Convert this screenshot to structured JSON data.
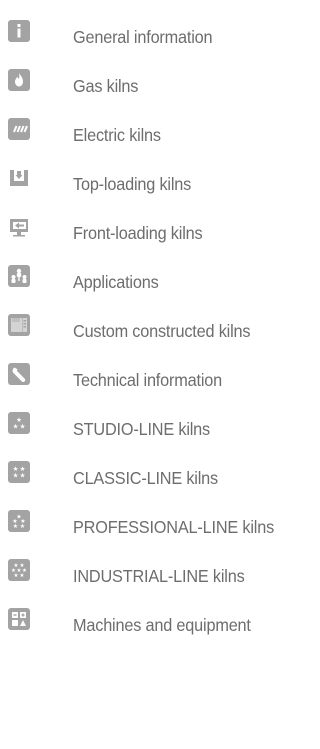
{
  "menu": {
    "items": [
      {
        "label": "General information",
        "icon": "info-icon"
      },
      {
        "label": "Gas kilns",
        "icon": "flame-icon"
      },
      {
        "label": "Electric kilns",
        "icon": "heating-element-icon"
      },
      {
        "label": "Top-loading kilns",
        "icon": "top-loading-icon"
      },
      {
        "label": "Front-loading kilns",
        "icon": "front-loading-icon"
      },
      {
        "label": "Applications",
        "icon": "applications-icon"
      },
      {
        "label": "Custom constructed kilns",
        "icon": "custom-kiln-icon"
      },
      {
        "label": "Technical information",
        "icon": "wrench-icon"
      },
      {
        "label": "STUDIO-LINE kilns",
        "icon": "stars-icon"
      },
      {
        "label": "CLASSIC-LINE kilns",
        "icon": "stars-icon"
      },
      {
        "label": "PROFESSIONAL-LINE kilns",
        "icon": "stars-icon"
      },
      {
        "label": "INDUSTRIAL-LINE kilns",
        "icon": "stars-icon"
      },
      {
        "label": "Machines and equipment",
        "icon": "machines-icon"
      }
    ]
  },
  "colors": {
    "icon_bg": "#a3a3a3",
    "label": "#6d6d6d",
    "background": "#ffffff"
  }
}
